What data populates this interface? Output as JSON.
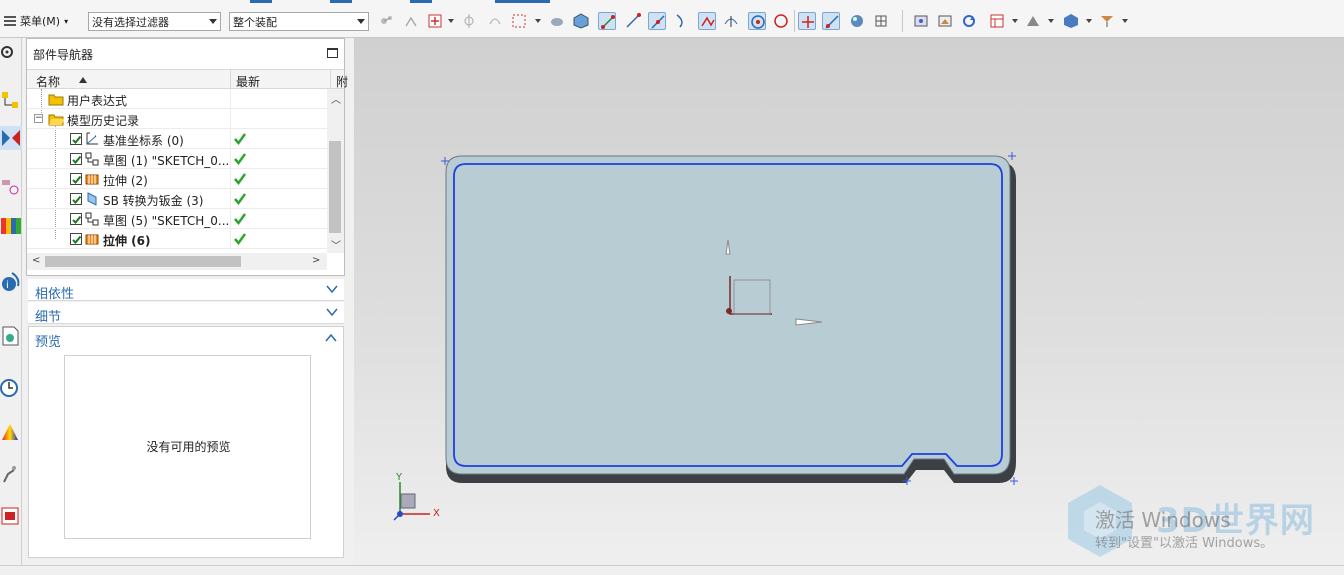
{
  "toolbar": {
    "menu_label": "菜单(M)",
    "filter_value": "没有选择过滤器",
    "assembly_value": "整个装配",
    "icons": [
      "snap-icon",
      "connect-icon",
      "add-icon",
      "move-icon",
      "link-icon",
      "select-box-icon",
      "shade-icon",
      "cube-icon",
      "point-snap-icon",
      "line-end-icon",
      "line-mid-icon",
      "curve-icon",
      "intersect-icon",
      "tangent-icon",
      "center-icon",
      "circle-icon",
      "cross-icon",
      "quadrant-icon",
      "sphere-icon",
      "grid-icon",
      "fit-icon",
      "render-icon",
      "refresh-icon",
      "view-layout-icon",
      "display-icon",
      "shaded-icon",
      "filter-icon"
    ]
  },
  "rail": {
    "icons": [
      "settings-icon",
      "assembly-nav-icon",
      "constraint-nav-icon",
      "part-nav-icon",
      "library-icon",
      "web-icon",
      "history-icon",
      "clock-icon",
      "color-icon",
      "robot-icon",
      "media-icon"
    ]
  },
  "navigator": {
    "title": "部件导航器",
    "columns": {
      "name": "名称",
      "latest": "最新",
      "extra": "附"
    },
    "rows": [
      {
        "label": "用户表达式",
        "indent": 1,
        "checked": false,
        "latest": false,
        "bold": false,
        "icon": "folder-icon"
      },
      {
        "label": "模型历史记录",
        "indent": 1,
        "checked": false,
        "latest": false,
        "bold": false,
        "icon": "folder-icon",
        "expanded": true
      },
      {
        "label": "基准坐标系 (0)",
        "indent": 2,
        "checked": true,
        "latest": true,
        "bold": false,
        "icon": "datum-csys-icon"
      },
      {
        "label": "草图 (1) \"SKETCH_0...",
        "indent": 2,
        "checked": true,
        "latest": true,
        "bold": false,
        "icon": "sketch-icon"
      },
      {
        "label": "拉伸 (2)",
        "indent": 2,
        "checked": true,
        "latest": true,
        "bold": false,
        "icon": "extrude-icon"
      },
      {
        "label": "SB 转换为钣金 (3)",
        "indent": 2,
        "checked": true,
        "latest": true,
        "bold": false,
        "icon": "sheetmetal-icon"
      },
      {
        "label": "草图 (5) \"SKETCH_0...",
        "indent": 2,
        "checked": true,
        "latest": true,
        "bold": false,
        "icon": "sketch-icon"
      },
      {
        "label": "拉伸 (6)",
        "indent": 2,
        "checked": true,
        "latest": true,
        "bold": true,
        "icon": "extrude-icon"
      }
    ]
  },
  "sections": {
    "dependencies": "相依性",
    "details": "细节",
    "preview": "预览",
    "preview_empty": "没有可用的预览"
  },
  "viewport": {
    "triad": {
      "x": "X",
      "y": "Y"
    },
    "plate_color": "#b8ccd4",
    "edge_color": "#1f3fe0"
  },
  "watermark": {
    "title": "激活 Windows",
    "subtitle": "转到\"设置\"以激活 Windows。",
    "brand": "3D世界网"
  }
}
